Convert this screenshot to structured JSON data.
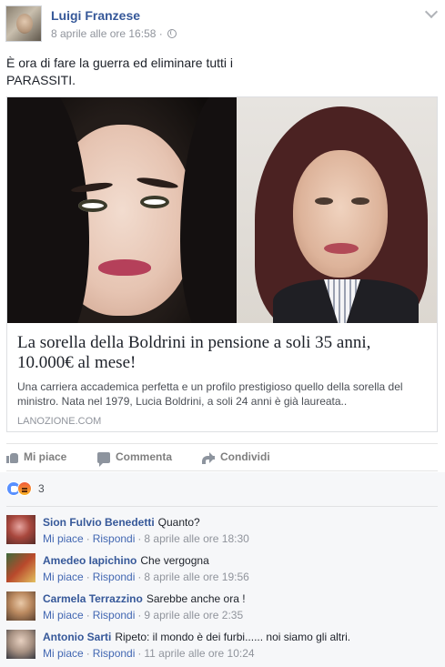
{
  "post": {
    "author": "Luigi Franzese",
    "date": "8 aprile alle ore 16:58",
    "meta_separator": "·",
    "text_line1": "È ora di fare la guerra ed eliminare tutti i",
    "text_line2": "PARASSITI."
  },
  "link_preview": {
    "title_line1": "La sorella della Boldrini in pensione a soli 35 anni,",
    "title_line2": "10.000€ al mese!",
    "description_line1": "Una carriera accademica perfetta e un profilo prestigioso quello della sorella del",
    "description_line2": "ministro. Nata nel 1979, Lucia Boldrini, a soli 24 anni è già laureata..",
    "domain": "LANOZIONE.COM"
  },
  "actions": {
    "like": "Mi piace",
    "comment": "Commenta",
    "share": "Condividi"
  },
  "reactions": {
    "count": "3",
    "types": [
      "like",
      "angry"
    ]
  },
  "comments": [
    {
      "author": "Sion Fulvio Benedetti",
      "text": "Quanto?",
      "like": "Mi piace",
      "reply": "Rispondi",
      "date": "8 aprile alle ore 18:30"
    },
    {
      "author": "Amedeo Iapichino",
      "text": "Che vergogna",
      "like": "Mi piace",
      "reply": "Rispondi",
      "date": "8 aprile alle ore 19:56"
    },
    {
      "author": "Carmela Terrazzino",
      "text": "Sarebbe anche ora !",
      "like": "Mi piace",
      "reply": "Rispondi",
      "date": "9 aprile alle ore 2:35"
    },
    {
      "author": "Antonio Sarti",
      "text": "Ripeto: il mondo è dei furbi...... noi siamo gli altri.",
      "like": "Mi piace",
      "reply": "Rispondi",
      "date": "11 aprile alle ore 10:24"
    }
  ],
  "colors": {
    "link_blue": "#365899",
    "muted_gray": "#90949c",
    "comments_bg": "#f6f7f9"
  }
}
